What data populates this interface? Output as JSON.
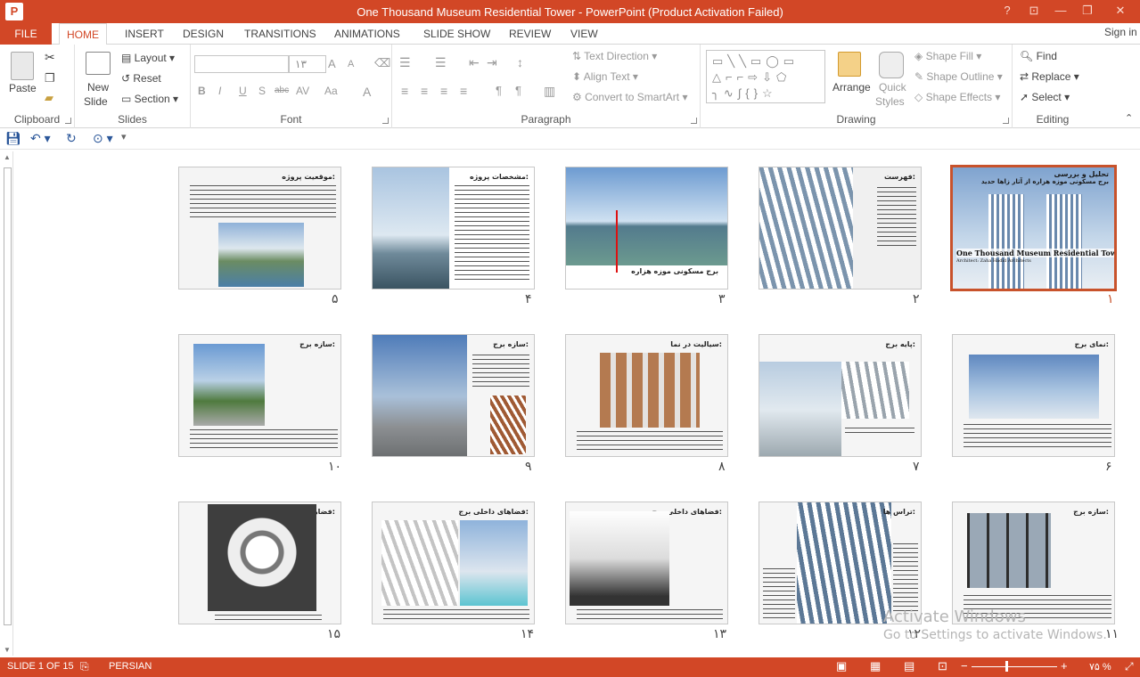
{
  "window": {
    "app_icon": "P",
    "title": "One Thousand Museum Residential Tower -  PowerPoint (Product Activation Failed)",
    "help": "?",
    "restore_ribbon": "⊡",
    "minimize": "—",
    "maximize": "❐",
    "close": "✕"
  },
  "tabs": {
    "file": "FILE",
    "items": [
      "HOME",
      "INSERT",
      "DESIGN",
      "TRANSITIONS",
      "ANIMATIONS",
      "SLIDE SHOW",
      "REVIEW",
      "VIEW"
    ],
    "active": "HOME",
    "signin": "Sign in"
  },
  "ribbon": {
    "clipboard": {
      "label": "Clipboard",
      "paste": "Paste"
    },
    "slides": {
      "label": "Slides",
      "new_slide_1": "New",
      "new_slide_2": "Slide",
      "layout": "Layout",
      "reset": "Reset",
      "section": "Section"
    },
    "font": {
      "label": "Font",
      "size": "۱۳",
      "bold": "B",
      "italic": "I",
      "underline": "U",
      "shadow": "S",
      "strike": "abc",
      "spacing": "AV",
      "case": "Aa",
      "color": "A",
      "grow": "A",
      "shrink": "A"
    },
    "paragraph": {
      "label": "Paragraph",
      "text_direction": "Text Direction",
      "align_text": "Align Text",
      "convert_smartart": "Convert to SmartArt"
    },
    "drawing": {
      "label": "Drawing",
      "arrange": "Arrange",
      "quick_styles_1": "Quick",
      "quick_styles_2": "Styles",
      "shape_fill": "Shape Fill",
      "shape_outline": "Shape Outline",
      "shape_effects": "Shape Effects"
    },
    "editing": {
      "label": "Editing",
      "find": "Find",
      "replace": "Replace",
      "select": "Select"
    }
  },
  "qat": {
    "save_icon": "save-icon",
    "undo_icon": "undo-icon",
    "redo_icon": "repeat-icon",
    "present_icon": "present-icon"
  },
  "slides": [
    {
      "num": "۱",
      "title": "تحلیل و بررسی",
      "selected": true
    },
    {
      "num": "۲",
      "title": "فهرست:",
      "selected": false
    },
    {
      "num": "۳",
      "title": "برج مسکونی موزه هزاره",
      "selected": false
    },
    {
      "num": "۴",
      "title": "مشخصات پروژه:",
      "selected": false
    },
    {
      "num": "۵",
      "title": "موقعیت پروژه:",
      "selected": false
    },
    {
      "num": "۶",
      "title": "نمای برج:",
      "selected": false
    },
    {
      "num": "۷",
      "title": "پایه برج:",
      "selected": false
    },
    {
      "num": "۸",
      "title": "سیالیت در نما:",
      "selected": false
    },
    {
      "num": "۹",
      "title": "سازه برج:",
      "selected": false
    },
    {
      "num": "۱۰",
      "title": "سازه برج:",
      "selected": false
    },
    {
      "num": "۱۱",
      "title": "سازه برج:",
      "selected": false
    },
    {
      "num": "۱۲",
      "title": "تراس ها:",
      "selected": false
    },
    {
      "num": "۱۳",
      "title": "فضاهای داخلی برج:",
      "selected": false
    },
    {
      "num": "۱۴",
      "title": "فضاهای داخلی برج:",
      "selected": false
    },
    {
      "num": "۱۵",
      "title": "فضاهای داخلی برج:",
      "selected": false
    }
  ],
  "slide1": {
    "subtitle": "برج مسکونی موزه هزاره از آثار زاها حدید",
    "en_title": "One Thousand Museum Residential Tower",
    "en_sub": "Architect: Zaha Hadid Architects"
  },
  "watermark": {
    "line1": "Activate Windows",
    "line2": "Go to Settings to activate Windows."
  },
  "status": {
    "slide": "SLIDE 1 OF 15",
    "language": "PERSIAN",
    "zoom": "۷۵ %"
  },
  "colors": {
    "accent": "#d24726",
    "selected_border": "#c8522b"
  }
}
